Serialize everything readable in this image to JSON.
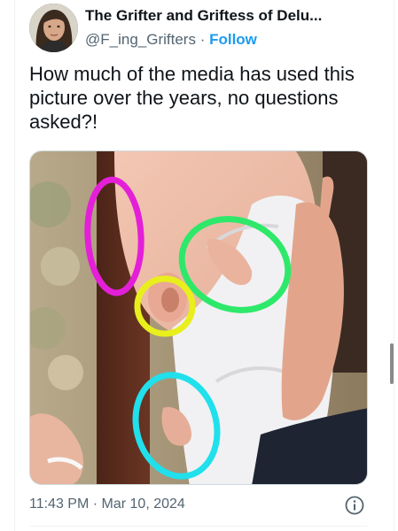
{
  "author": {
    "display_name": "The Grifter and Griftess of Delu...",
    "handle": "@F_ing_Grifters",
    "separator": " · ",
    "follow_label": "Follow"
  },
  "tweet": {
    "text": "How much of the media has used this picture over the years, no questions asked?!",
    "timestamp": "11:43 PM · Mar 10, 2024"
  },
  "media": {
    "annotation_circles": [
      {
        "color": "#e41fd8",
        "label": "magenta"
      },
      {
        "color": "#2ee86a",
        "label": "green"
      },
      {
        "color": "#e8ef1c",
        "label": "yellow"
      },
      {
        "color": "#20e0ec",
        "label": "cyan"
      }
    ]
  },
  "icons": {
    "info": "info-circle-icon"
  },
  "colors": {
    "link": "#1d9bf0",
    "secondary_text": "#536471",
    "primary_text": "#0f1419"
  }
}
